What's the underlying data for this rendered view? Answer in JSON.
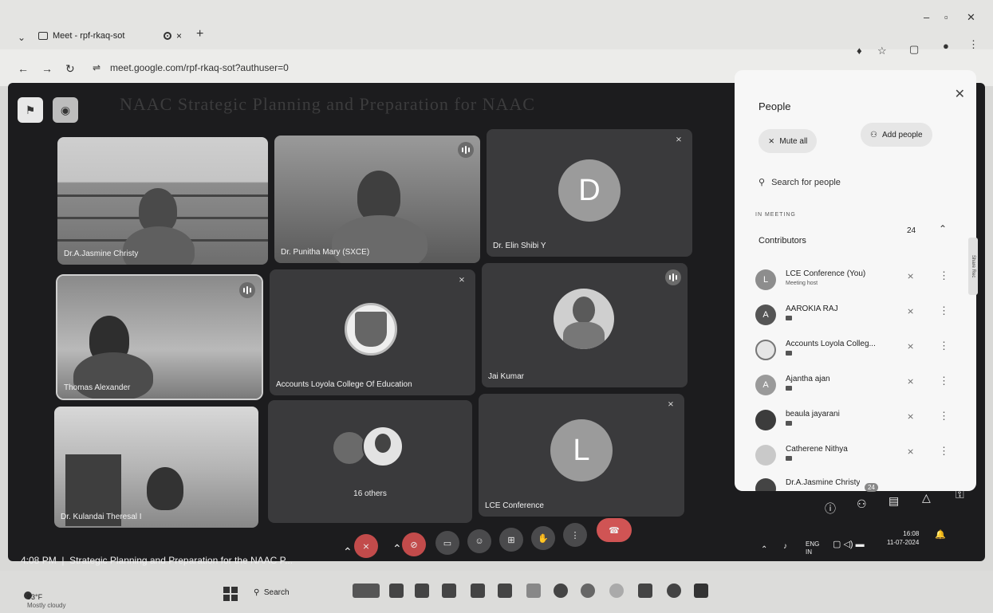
{
  "browser": {
    "tab_title": "Meet - rpf-rkaq-sot",
    "url": "meet.google.com/rpf-rkaq-sot?authuser=0"
  },
  "stage": {
    "watermark_title": "NAAC Strategic Planning and Preparation for NAAC"
  },
  "tiles": [
    {
      "name": "Dr.A.Jasmine Christy"
    },
    {
      "name": "Dr. Punitha Mary (SXCE)"
    },
    {
      "name": "Dr. Elin Shibi Y",
      "initial": "D"
    },
    {
      "name": "Thomas Alexander"
    },
    {
      "name": "Accounts Loyola College Of Education"
    },
    {
      "name": "Jai Kumar"
    },
    {
      "name": "Dr. Kulandai Theresal I"
    },
    {
      "name": "16 others"
    },
    {
      "name": "LCE Conference",
      "initial": "L"
    }
  ],
  "people_panel": {
    "title": "People",
    "mute_all": "Mute all",
    "add_people": "Add people",
    "search_placeholder": "Search for people",
    "section": "IN MEETING",
    "group": "Contributors",
    "count": "24",
    "rows": [
      {
        "name": "LCE Conference (You)",
        "sub": "Meeting host",
        "initial": "L"
      },
      {
        "name": "AAROKIA RAJ",
        "initial": "A"
      },
      {
        "name": "Accounts Loyola Colleg...",
        "initial": ""
      },
      {
        "name": "Ajantha ajan",
        "initial": "A"
      },
      {
        "name": "beaula jayarani",
        "initial": ""
      },
      {
        "name": "Catherene Nithya",
        "initial": ""
      },
      {
        "name": "Dr.A.Jasmine Christy",
        "initial": ""
      }
    ],
    "side_tab": "Share Rec"
  },
  "bottom_bar": {
    "time": "4:08 PM",
    "meeting_title": "Strategic Planning and Preparation for the NAAC P...",
    "people_badge": "24"
  },
  "system_tray": {
    "lang": "ENG",
    "region": "IN",
    "time": "16:08",
    "date": "11-07-2024"
  },
  "taskbar": {
    "temp": "93°F",
    "weather": "Mostly cloudy",
    "search": "Search"
  }
}
